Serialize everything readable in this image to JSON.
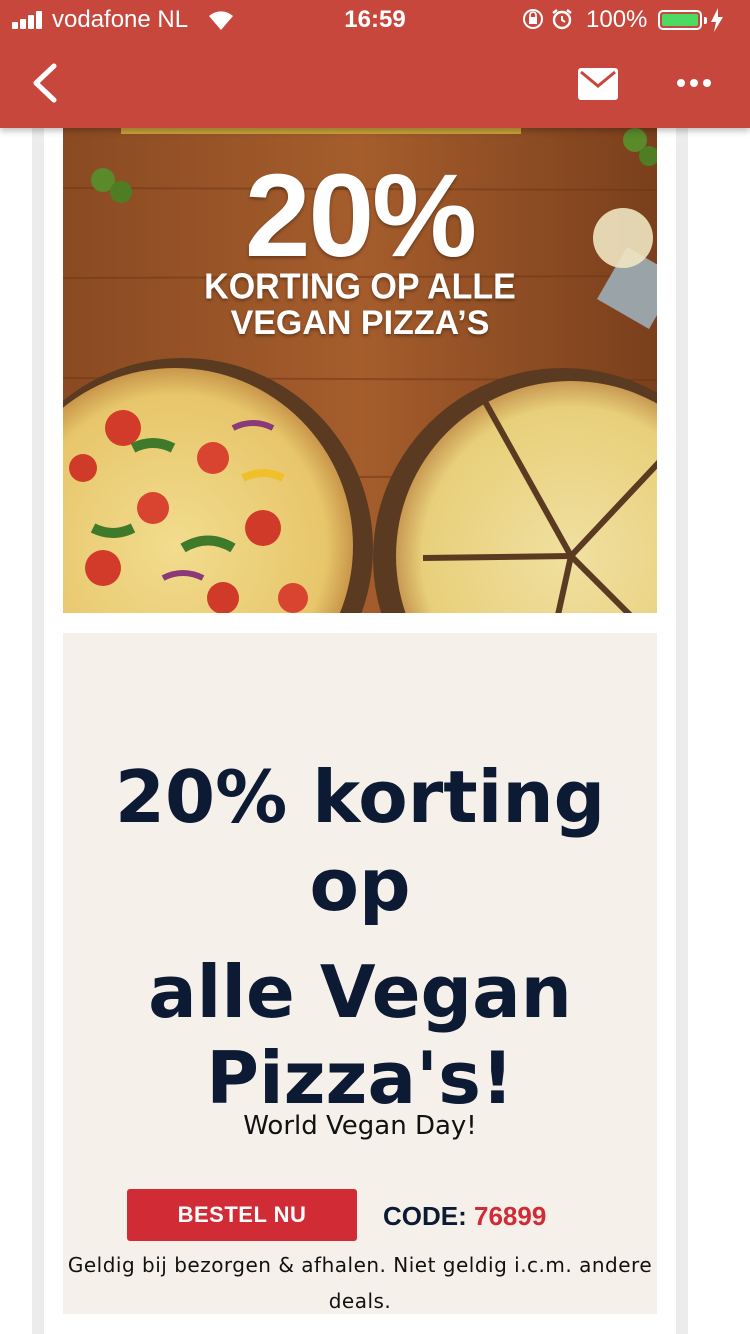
{
  "status_bar": {
    "carrier": "vodafone NL",
    "time": "16:59",
    "battery_percent": "100%"
  },
  "nav": {
    "back_icon": "chevron-left-icon",
    "mail_icon": "envelope-icon",
    "more_icon": "ellipsis-icon"
  },
  "hero": {
    "big_text": "20%",
    "line1": "KORTING OP ALLE",
    "line2": "VEGAN PIZZA’S"
  },
  "promo": {
    "headline_line1": "20% korting op",
    "headline_line2": "alle Vegan Pizza's!",
    "subline": "World Vegan Day!",
    "cta_label": "BESTEL NU",
    "code_label": "CODE:",
    "code_value": "76899",
    "terms": "Geldig bij bezorgen & afhalen. Niet geldig i.c.m. andere deals."
  },
  "colors": {
    "header": "#c8473d",
    "cta": "#d12b35",
    "headline": "#0c1a33",
    "promo_bg": "#f5f0ea"
  }
}
